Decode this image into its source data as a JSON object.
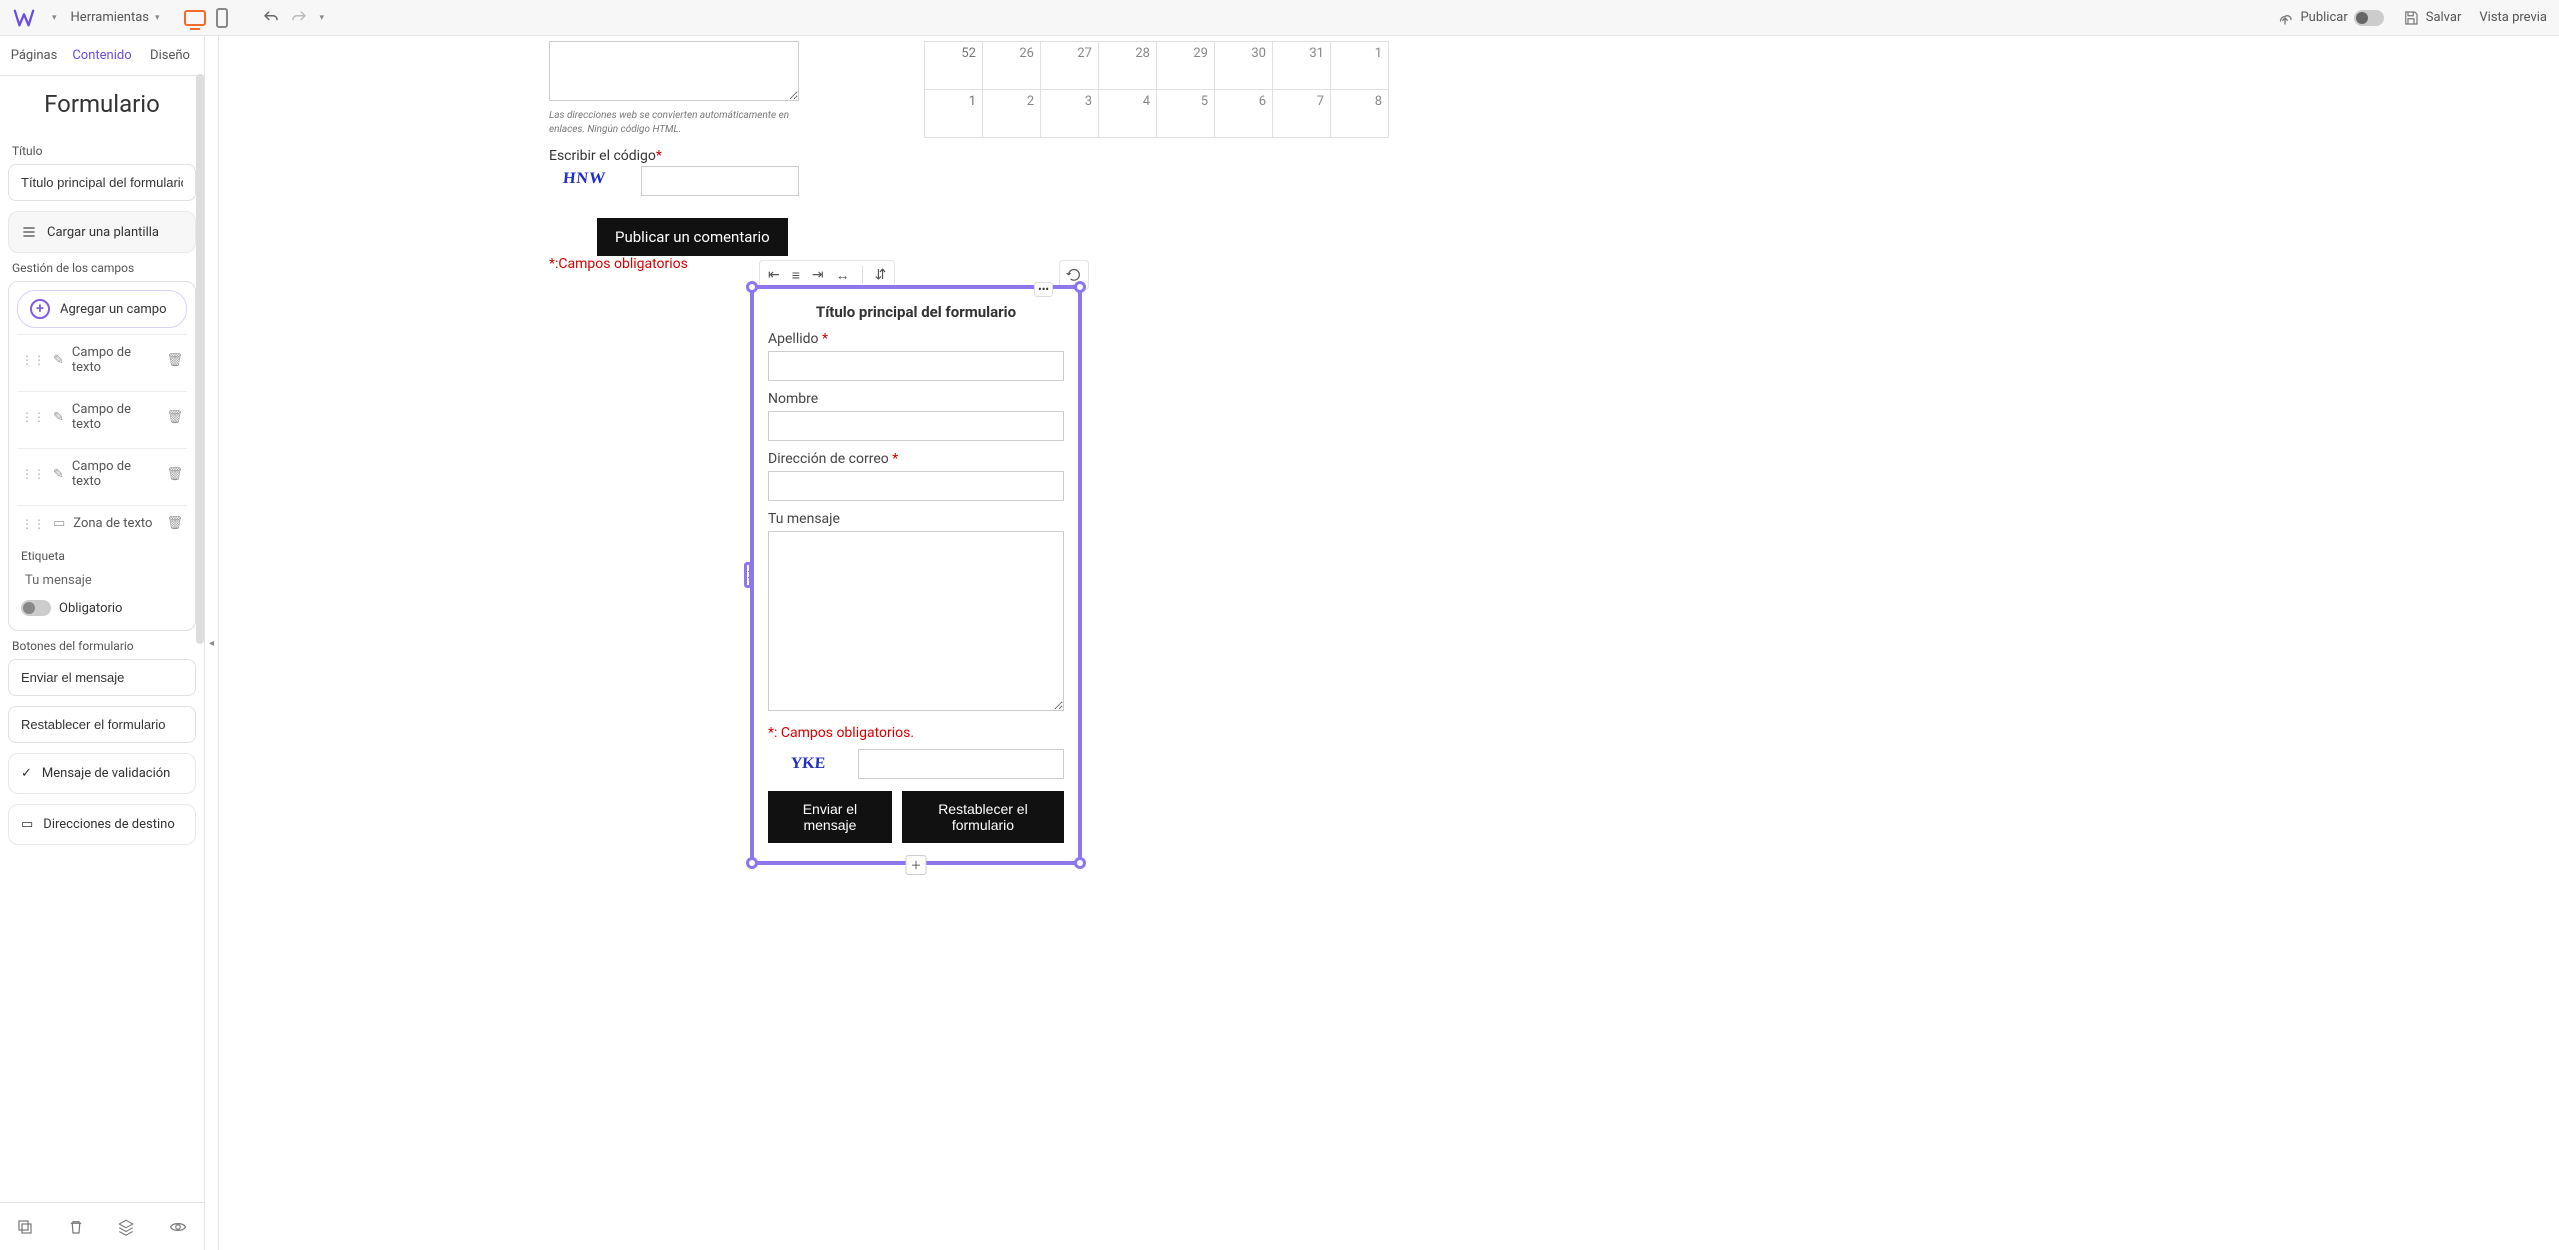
{
  "topbar": {
    "tools": "Herramientas",
    "publish": "Publicar",
    "save": "Salvar",
    "preview": "Vista previa"
  },
  "sidebar": {
    "tabs": {
      "pages": "Páginas",
      "content": "Contenido",
      "design": "Diseño"
    },
    "title": "Formulario",
    "title_label": "Título",
    "title_value": "Título principal del formulario",
    "load_template": "Cargar una plantilla",
    "fields_label": "Gestión de los campos",
    "add_field": "Agregar un campo",
    "fields": [
      {
        "label": "Campo de texto"
      },
      {
        "label": "Campo de texto"
      },
      {
        "label": "Campo de texto"
      },
      {
        "label": "Zona de texto"
      }
    ],
    "etiqueta": "Etiqueta",
    "etiqueta_value": "Tu mensaje",
    "required": "Obligatorio",
    "buttons_label": "Botones del formulario",
    "send_btn": "Enviar el mensaje",
    "reset_btn": "Restablecer el formulario",
    "validation_msg": "Mensaje de validación",
    "target_addresses": "Direcciones de destino"
  },
  "canvas": {
    "comment_hint": "Las direcciones web se convierten automáticamente en enlaces. Ningún código HTML.",
    "captcha_label": "Escribir el código",
    "captcha1": "HNW",
    "publish_comment": "Publicar un comentario",
    "req_note": "*:Campos obligatorios",
    "calendar": {
      "rows": [
        [
          "52",
          "26",
          "27",
          "28",
          "29",
          "30",
          "31",
          "1"
        ],
        [
          "1",
          "2",
          "3",
          "4",
          "5",
          "6",
          "7",
          "8"
        ]
      ]
    }
  },
  "form_widget": {
    "title": "Título principal del formulario",
    "fields": {
      "apellido": "Apellido",
      "nombre": "Nombre",
      "email": "Dirección de correo",
      "mensaje": "Tu mensaje"
    },
    "req_note": "*: Campos obligatorios.",
    "captcha": "YKE",
    "send": "Enviar el mensaje",
    "reset": "Restablecer el formulario"
  }
}
